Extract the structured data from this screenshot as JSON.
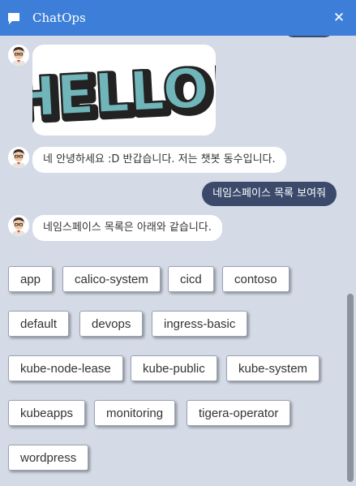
{
  "header": {
    "title": "ChatOps",
    "close_label": "✕"
  },
  "messages": {
    "image_text": "HELLO!",
    "greeting": "네 안녕하세요 :D 반갑습니다. 저는 챗봇 동수입니다.",
    "user_request": "네임스페이스 목록 보여줘",
    "namespace_intro": "네임스페이스 목록은 아래와 같습니다."
  },
  "namespaces": [
    "app",
    "calico-system",
    "cicd",
    "contoso",
    "default",
    "devops",
    "ingress-basic",
    "kube-node-lease",
    "kube-public",
    "kube-system",
    "kubeapps",
    "monitoring",
    "tigera-operator",
    "wordpress"
  ],
  "colors": {
    "header": "#3d7fd8",
    "background": "#d4dae6",
    "user_bubble": "#3b4a6b",
    "bot_bubble": "#ffffff",
    "hello_fill": "#6fb5b9",
    "hello_outline": "#222222"
  },
  "icons": {
    "header": "chat-bubble-icon",
    "close": "close-icon",
    "avatar": "bot-avatar"
  }
}
